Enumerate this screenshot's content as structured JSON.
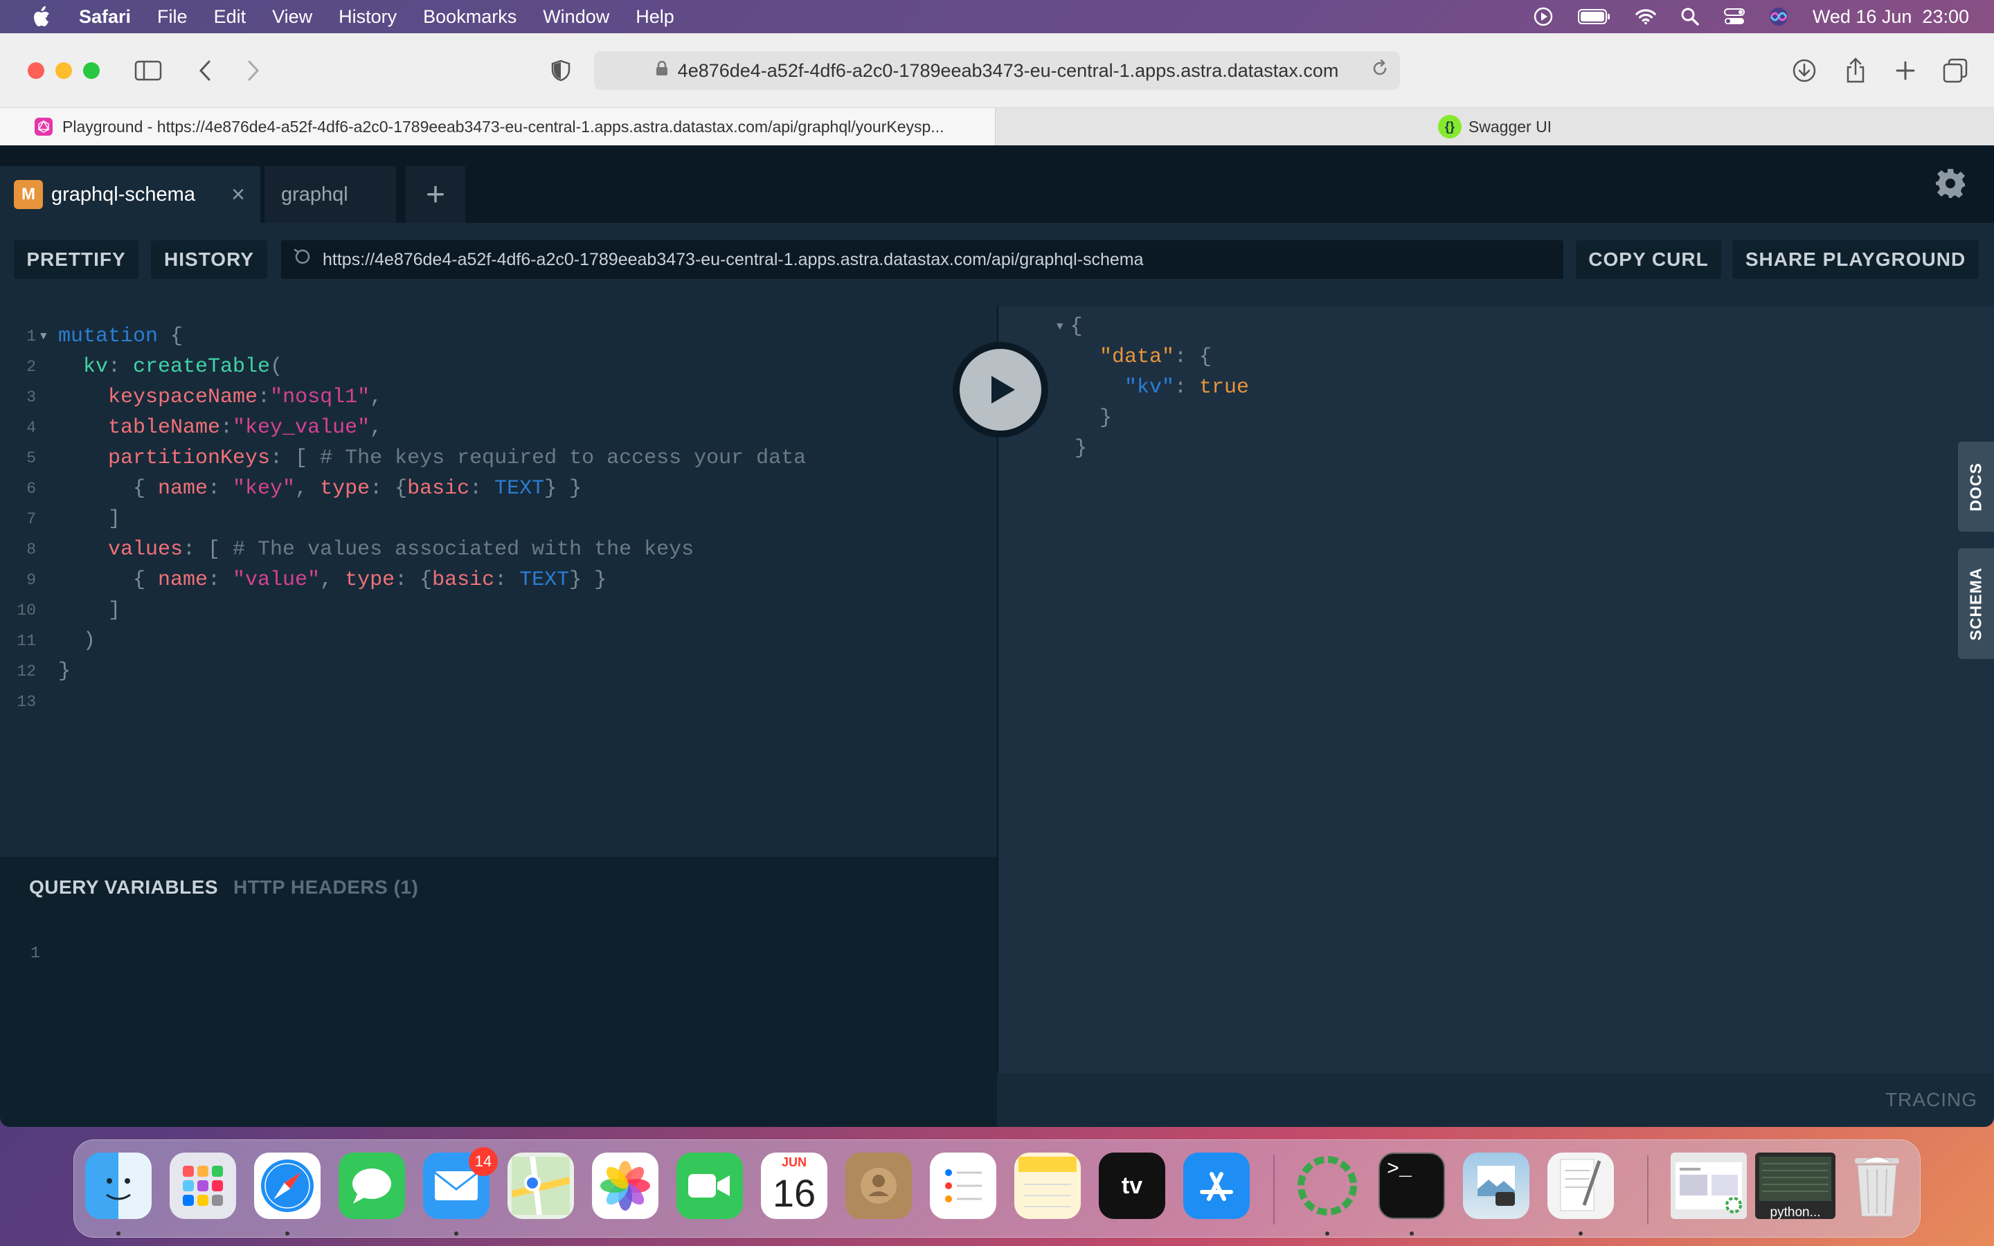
{
  "menubar": {
    "app": "Safari",
    "items": [
      "File",
      "Edit",
      "View",
      "History",
      "Bookmarks",
      "Window",
      "Help"
    ],
    "clock": "Wed 16 Jun  23:00"
  },
  "browser": {
    "url": "4e876de4-a52f-4df6-a2c0-1789eeab3473-eu-central-1.apps.astra.datastax.com",
    "tabs": [
      {
        "label": "Playground - https://4e876de4-a52f-4df6-a2c0-1789eeab3473-eu-central-1.apps.astra.datastax.com/api/graphql/yourKeysp..."
      },
      {
        "label": "Swagger UI"
      }
    ]
  },
  "playground": {
    "tabs": [
      {
        "badge": "M",
        "label": "graphql-schema"
      },
      {
        "label": "graphql"
      }
    ],
    "add_tab": "+",
    "toolbar": {
      "prettify": "PRETTIFY",
      "history": "HISTORY",
      "endpoint": "https://4e876de4-a52f-4df6-a2c0-1789eeab3473-eu-central-1.apps.astra.datastax.com/api/graphql-schema",
      "copy_curl": "COPY CURL",
      "share": "SHARE PLAYGROUND"
    },
    "line_numbers": [
      "1",
      "2",
      "3",
      "4",
      "5",
      "6",
      "7",
      "8",
      "9",
      "10",
      "11",
      "12",
      "13"
    ],
    "query_lines": {
      "l1_kw": "mutation",
      "l1_p": " {",
      "l2_alias": "kv",
      "l2_colon": ": ",
      "l2_fn": "createTable",
      "l2_p": "(",
      "l3_arg": "keyspaceName",
      "l3_colon": ":",
      "l3_str": "\"nosql1\"",
      "l3_p": ",",
      "l4_arg": "tableName",
      "l4_colon": ":",
      "l4_str": "\"key_value\"",
      "l4_p": ",",
      "l5_arg": "partitionKeys",
      "l5_colon": ": [ ",
      "l5_com": "# The keys required to access your data",
      "l6_a": "{ ",
      "l6_name": "name",
      "l6_c1": ": ",
      "l6_str": "\"key\"",
      "l6_c2": ", ",
      "l6_type": "type",
      "l6_c3": ": {",
      "l6_basic": "basic",
      "l6_c4": ": ",
      "l6_enum": "TEXT",
      "l6_end": "} }",
      "l7": "]",
      "l8_arg": "values",
      "l8_colon": ": [ ",
      "l8_com": "# The values associated with the keys",
      "l9_a": "{ ",
      "l9_name": "name",
      "l9_c1": ": ",
      "l9_str": "\"value\"",
      "l9_c2": ", ",
      "l9_type": "type",
      "l9_c3": ": {",
      "l9_basic": "basic",
      "l9_c4": ": ",
      "l9_enum": "TEXT",
      "l9_end": "} }",
      "l10": "]",
      "l11": ")",
      "l12": "}"
    },
    "result_lines": {
      "r1": "{",
      "r2_key": "\"data\"",
      "r2_p": ": {",
      "r3_key": "\"kv\"",
      "r3_p": ": ",
      "r3_val": "true",
      "r4": "}",
      "r5": "}"
    },
    "variables": {
      "tab_query_variables": "QUERY VARIABLES",
      "tab_http_headers": "HTTP HEADERS (1)",
      "line1": "1"
    },
    "side_tabs": {
      "docs": "DOCS",
      "schema": "SCHEMA"
    },
    "tracing": "TRACING"
  },
  "dock": {
    "calendar_month": "JUN",
    "calendar_day": "16",
    "mail_badge": "14",
    "python_label": "python..."
  }
}
